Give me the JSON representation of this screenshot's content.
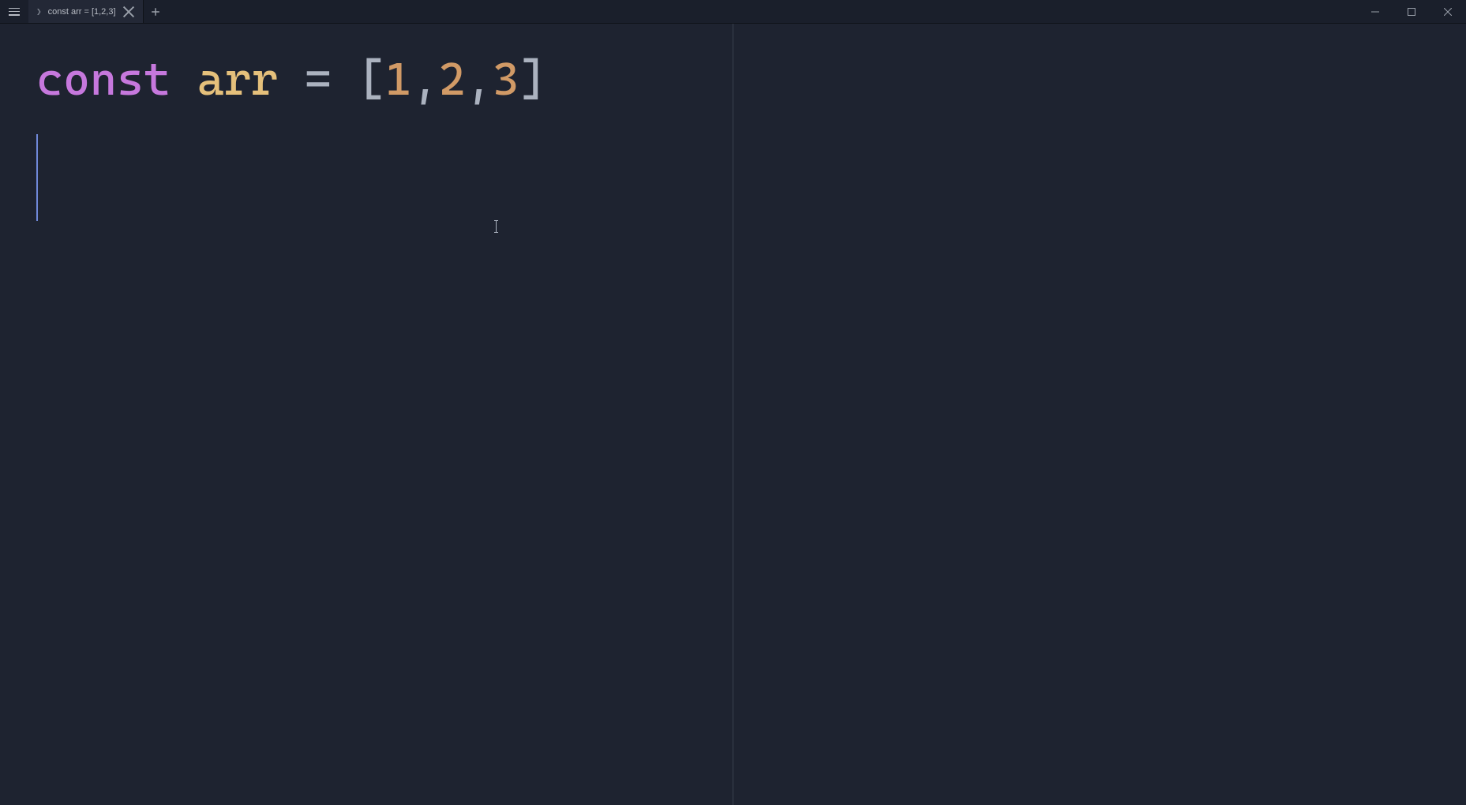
{
  "tab": {
    "prompt": "❯",
    "title": "const arr = [1,2,3]"
  },
  "code": {
    "keyword": "const",
    "sp1": " ",
    "ident": "arr",
    "sp2": " ",
    "eq": "=",
    "sp3": " ",
    "lbracket": "[",
    "n1": "1",
    "c1": ",",
    "n2": "2",
    "c2": ",",
    "n3": "3",
    "rbracket": "]"
  }
}
